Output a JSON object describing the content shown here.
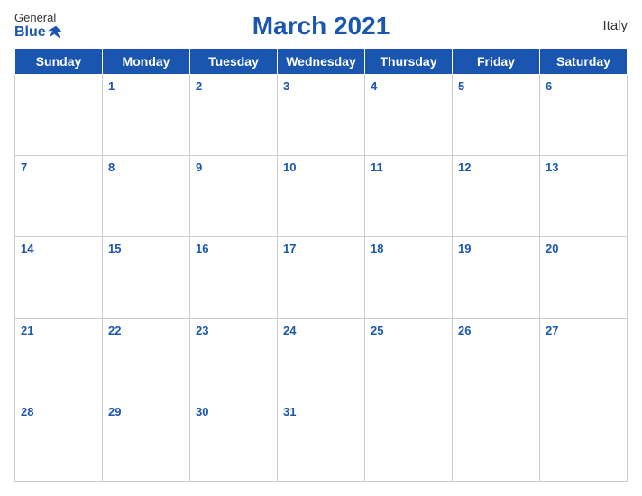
{
  "header": {
    "logo_general": "General",
    "logo_blue": "Blue",
    "title": "March 2021",
    "country": "Italy"
  },
  "days_of_week": [
    "Sunday",
    "Monday",
    "Tuesday",
    "Wednesday",
    "Thursday",
    "Friday",
    "Saturday"
  ],
  "weeks": [
    [
      null,
      "1",
      "2",
      "3",
      "4",
      "5",
      "6"
    ],
    [
      "7",
      "8",
      "9",
      "10",
      "11",
      "12",
      "13"
    ],
    [
      "14",
      "15",
      "16",
      "17",
      "18",
      "19",
      "20"
    ],
    [
      "21",
      "22",
      "23",
      "24",
      "25",
      "26",
      "27"
    ],
    [
      "28",
      "29",
      "30",
      "31",
      null,
      null,
      null
    ]
  ]
}
